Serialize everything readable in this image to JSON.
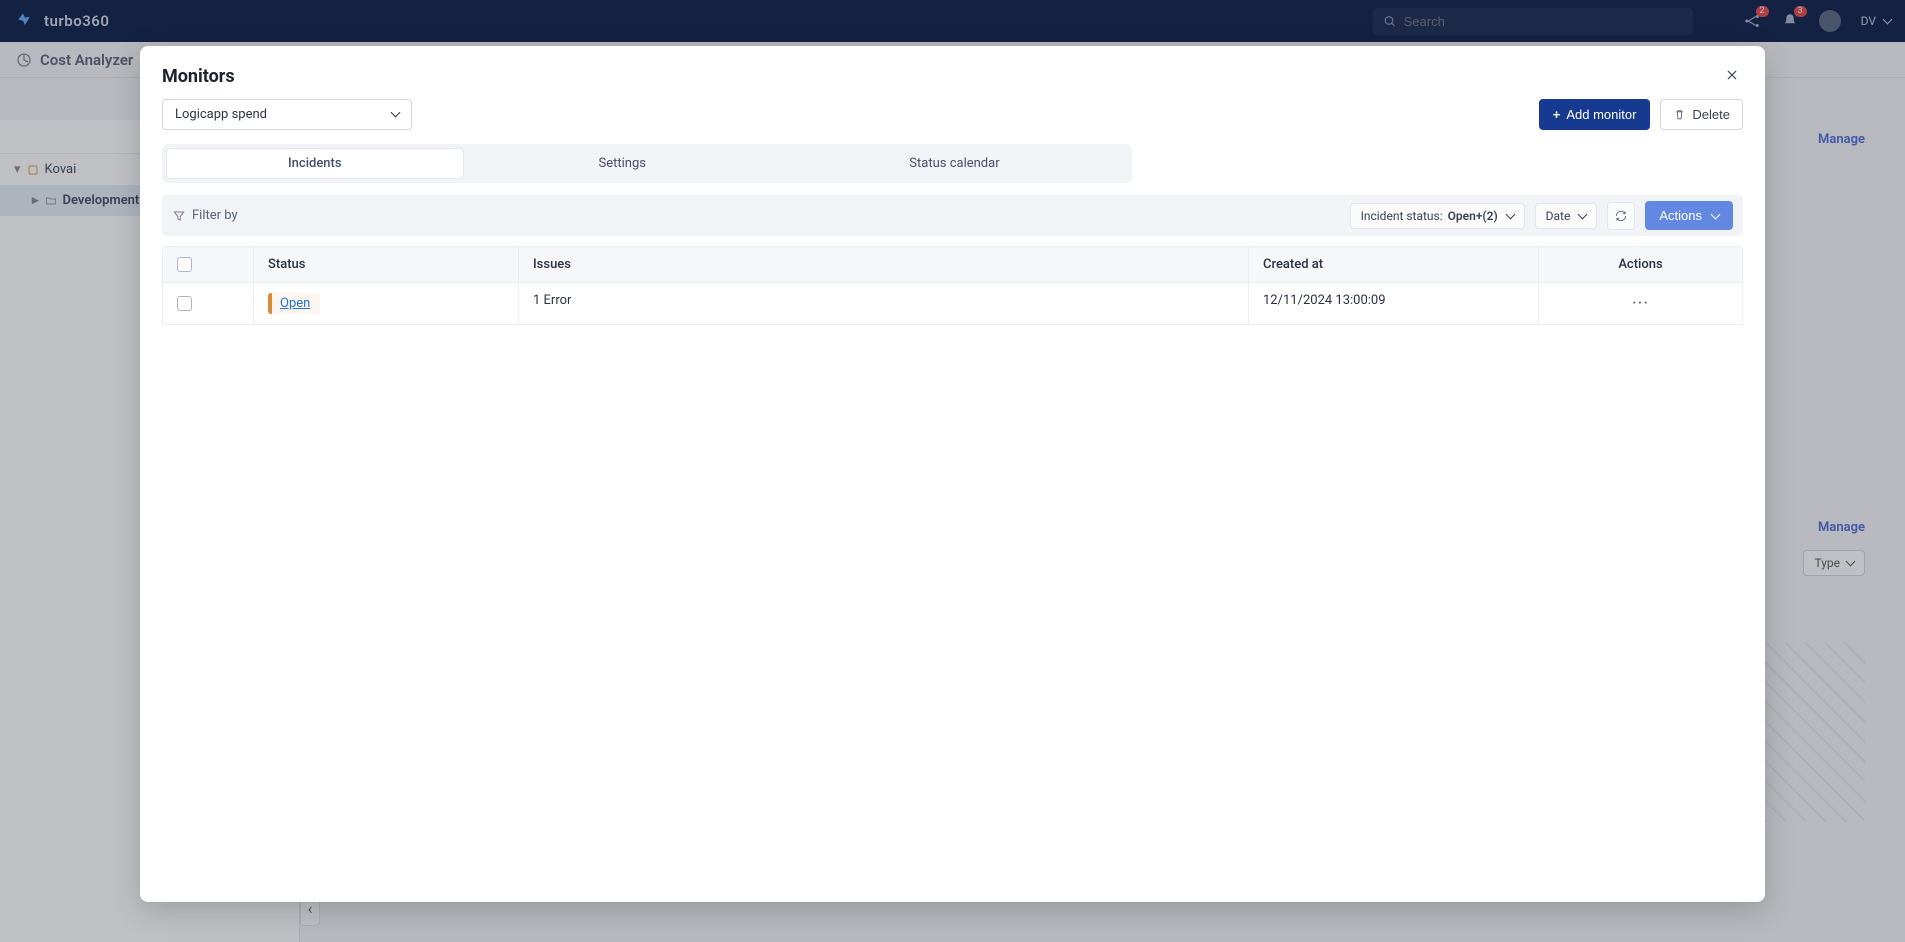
{
  "header": {
    "brand": "turbo360",
    "search_placeholder": "Search",
    "notif1_badge": "2",
    "notif2_badge": "3",
    "user_code": "DV"
  },
  "bg": {
    "page_title": "Cost Analyzer",
    "tree_root": "Kovai",
    "tree_child": "Development",
    "manage": "Manage",
    "type": "Type"
  },
  "modal": {
    "title": "Monitors",
    "selected_monitor": "Logicapp spend",
    "add_monitor": "Add monitor",
    "delete": "Delete",
    "tabs": [
      "Incidents",
      "Settings",
      "Status calendar"
    ],
    "filter_by": "Filter by",
    "status_label": "Incident status:",
    "status_value": "Open+(2)",
    "date_label": "Date",
    "actions_btn": "Actions",
    "columns": {
      "status": "Status",
      "issues": "Issues",
      "created": "Created at",
      "actions": "Actions"
    },
    "rows": [
      {
        "status": "Open",
        "issues": "1 Error",
        "created": "12/11/2024 13:00:09"
      }
    ]
  }
}
